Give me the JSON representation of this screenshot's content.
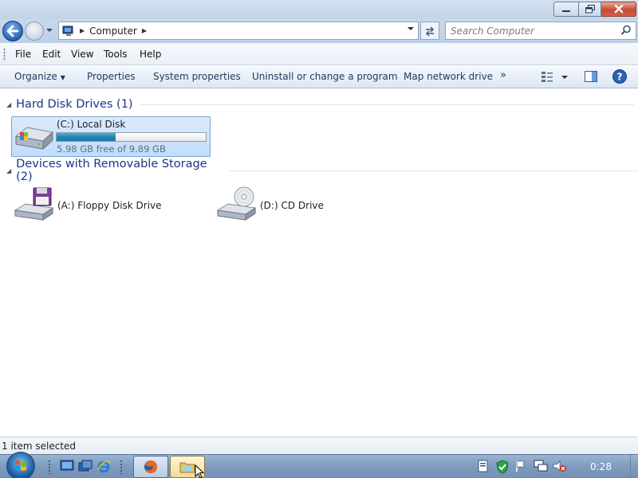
{
  "window": {
    "caption_buttons": [
      "minimize",
      "maximize",
      "close"
    ]
  },
  "address_bar": {
    "breadcrumb": "Computer",
    "search_placeholder": "Search Computer"
  },
  "menu": {
    "file": "File",
    "edit": "Edit",
    "view": "View",
    "tools": "Tools",
    "help": "Help"
  },
  "command_bar": {
    "organize": "Organize",
    "properties": "Properties",
    "system_properties": "System properties",
    "uninstall": "Uninstall or change a program",
    "map_drive": "Map network drive",
    "more": "»"
  },
  "groups": {
    "hard_disks": {
      "title": "Hard Disk Drives (1)",
      "drive": {
        "name": "(C:) Local Disk",
        "free_text": "5.98 GB free of 9.89 GB",
        "used_fraction": 0.395
      }
    },
    "removable": {
      "title": "Devices with Removable Storage (2)",
      "floppy": "(A:) Floppy Disk Drive",
      "cd": "(D:) CD Drive"
    }
  },
  "status": {
    "text": "1 item selected"
  },
  "taskbar": {
    "clock": "0:28"
  },
  "colors": {
    "group_title": "#1e3287",
    "selection": "#c1dcfc",
    "usage_bar": "#2284b3"
  }
}
